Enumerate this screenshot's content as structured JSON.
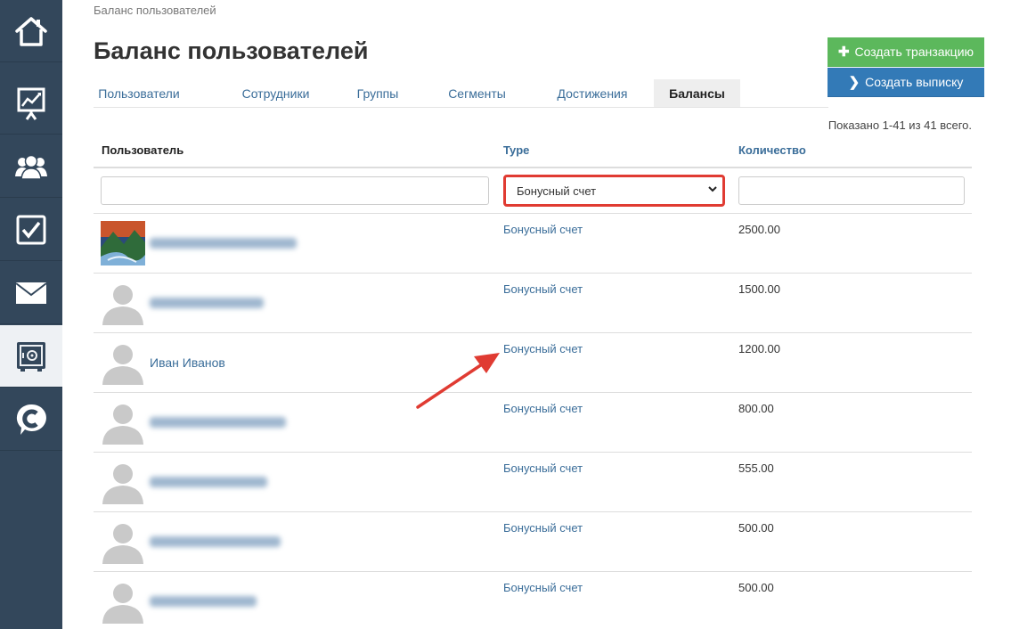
{
  "breadcrumb": "Баланс пользователей",
  "page_title": "Баланс пользователей",
  "actions": {
    "create_transaction": "Создать транзакцию",
    "create_statement": "Создать выписку"
  },
  "tabs": [
    {
      "label": "Пользователи"
    },
    {
      "label": "Сотрудники"
    },
    {
      "label": "Группы"
    },
    {
      "label": "Сегменты"
    },
    {
      "label": "Достижения"
    },
    {
      "label": "Балансы",
      "active": true
    }
  ],
  "summary": "Показано 1-41 из 41 всего.",
  "table": {
    "columns": [
      "Пользователь",
      "Type",
      "Количество"
    ],
    "filters": {
      "user": "",
      "type_selected": "Бонусный счет",
      "quantity": ""
    },
    "rows": [
      {
        "name": "",
        "name_blurred": true,
        "avatar": "photo",
        "type": "Бонусный счет",
        "quantity": "2500.00"
      },
      {
        "name": "",
        "name_blurred": true,
        "avatar": "placeholder",
        "type": "Бонусный счет",
        "quantity": "1500.00"
      },
      {
        "name": "Иван Иванов",
        "name_blurred": false,
        "avatar": "placeholder",
        "type": "Бонусный счет",
        "quantity": "1200.00"
      },
      {
        "name": "",
        "name_blurred": true,
        "avatar": "placeholder",
        "type": "Бонусный счет",
        "quantity": "800.00"
      },
      {
        "name": "",
        "name_blurred": true,
        "avatar": "placeholder",
        "type": "Бонусный счет",
        "quantity": "555.00"
      },
      {
        "name": "",
        "name_blurred": true,
        "avatar": "placeholder",
        "type": "Бонусный счет",
        "quantity": "500.00"
      },
      {
        "name": "",
        "name_blurred": true,
        "avatar": "placeholder",
        "type": "Бонусный счет",
        "quantity": "500.00"
      }
    ]
  },
  "sidebar": {
    "items": [
      {
        "icon": "home-icon"
      },
      {
        "icon": "presentation-chart-icon"
      },
      {
        "icon": "users-icon"
      },
      {
        "icon": "checkbox-icon"
      },
      {
        "icon": "envelope-icon"
      },
      {
        "icon": "safe-icon",
        "active": true
      },
      {
        "icon": "brand-c-icon"
      }
    ]
  },
  "colors": {
    "sidebar_bg": "#33475b",
    "link": "#3a6d99",
    "green_button": "#5cb85c",
    "blue_button": "#337ab7",
    "highlight_red": "#e03b32"
  }
}
